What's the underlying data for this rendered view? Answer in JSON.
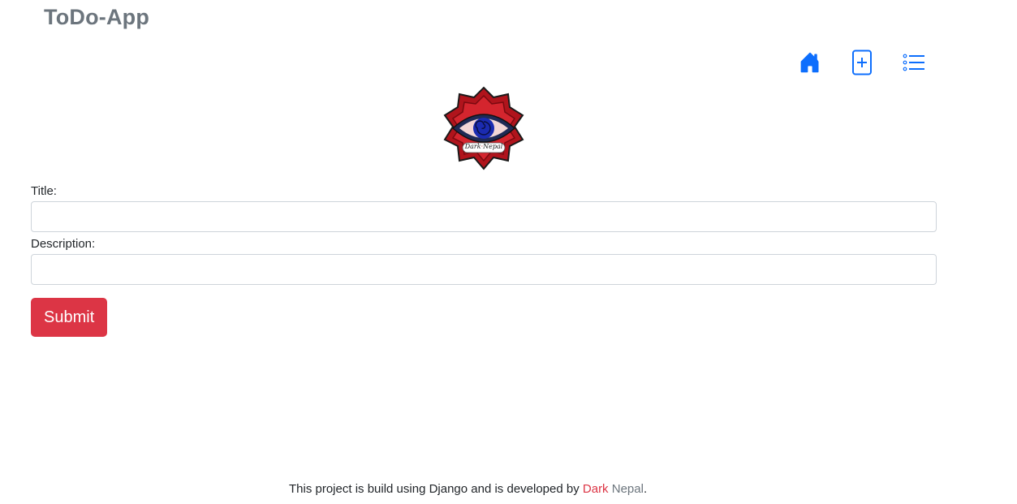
{
  "header": {
    "brand": "ToDo-App"
  },
  "nav": {
    "items": [
      {
        "icon": "home-icon",
        "label": "Home"
      },
      {
        "icon": "add-task-icon",
        "label": "Add"
      },
      {
        "icon": "list-icon",
        "label": "List"
      }
    ],
    "icon_color": "#0d6efd"
  },
  "logo": {
    "text_dark": "Dark",
    "text_nepal": "Nepal"
  },
  "form": {
    "title_label": "Title:",
    "title_value": "",
    "description_label": "Description:",
    "description_value": "",
    "submit_label": "Submit",
    "submit_color": "#dc3545"
  },
  "footer": {
    "text": "This project is build using Django and is developed by ",
    "author_first": "Dark",
    "author_second": "Nepal",
    "suffix": "."
  }
}
